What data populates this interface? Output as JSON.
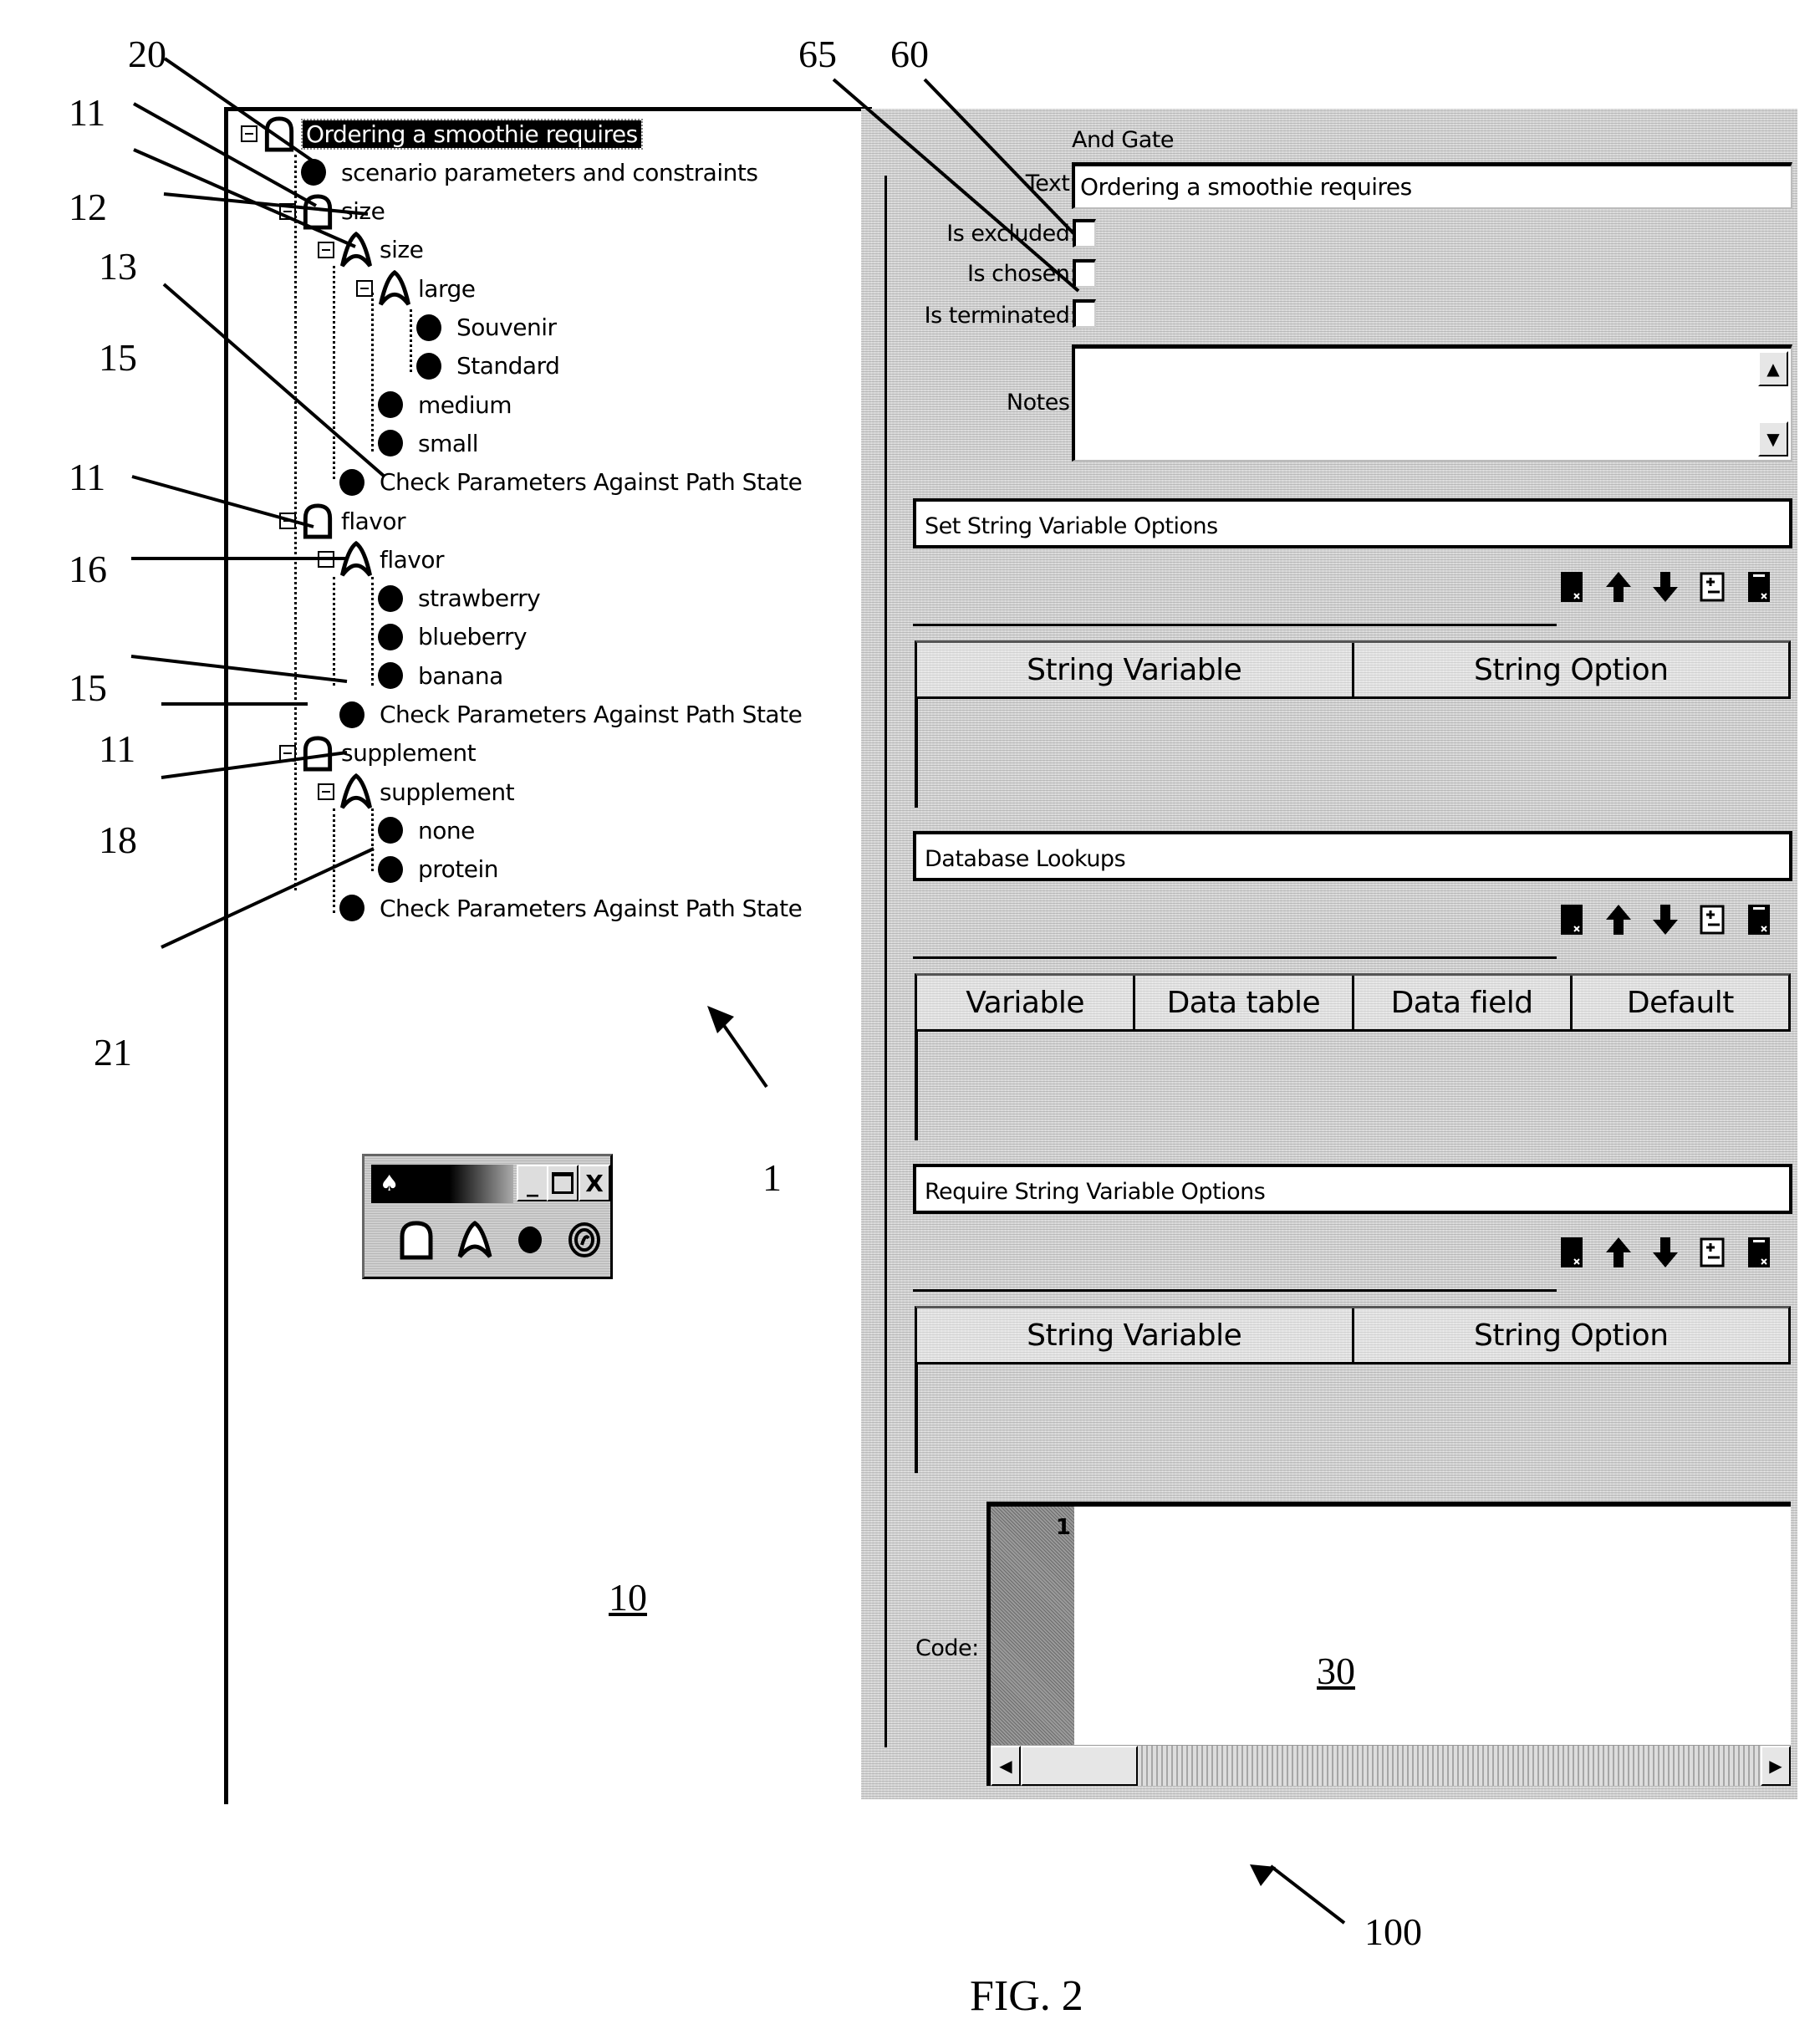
{
  "figure": {
    "caption": "FIG. 2",
    "reference_numerals": {
      "r20": "20",
      "r11a": "11",
      "r12": "12",
      "r13": "13",
      "r15a": "15",
      "r11b": "11",
      "r16": "16",
      "r15b": "15",
      "r11c": "11",
      "r18": "18",
      "r21": "21",
      "r1": "1",
      "r10": "10",
      "r30": "30",
      "r65": "65",
      "r60": "60",
      "r100": "100"
    }
  },
  "tree": {
    "rows": [
      {
        "label": "Ordering a smoothie requires",
        "icon": "and-gate-icon",
        "selected": true
      },
      {
        "label": "scenario parameters and constraints",
        "icon": "leaf-node-icon"
      },
      {
        "label": "size",
        "icon": "and-gate-icon"
      },
      {
        "label": "size",
        "icon": "or-gate-icon"
      },
      {
        "label": "large",
        "icon": "or-gate-icon"
      },
      {
        "label": "Souvenir",
        "icon": "leaf-node-icon"
      },
      {
        "label": "Standard",
        "icon": "leaf-node-icon"
      },
      {
        "label": "medium",
        "icon": "leaf-node-icon"
      },
      {
        "label": "small",
        "icon": "leaf-node-icon"
      },
      {
        "label": "Check Parameters Against Path State",
        "icon": "leaf-node-icon"
      },
      {
        "label": "flavor",
        "icon": "and-gate-icon"
      },
      {
        "label": "flavor",
        "icon": "or-gate-icon"
      },
      {
        "label": "strawberry",
        "icon": "leaf-node-icon"
      },
      {
        "label": "blueberry",
        "icon": "leaf-node-icon"
      },
      {
        "label": "banana",
        "icon": "leaf-node-icon"
      },
      {
        "label": "Check Parameters Against Path State",
        "icon": "leaf-node-icon"
      },
      {
        "label": "supplement",
        "icon": "and-gate-icon"
      },
      {
        "label": "supplement",
        "icon": "or-gate-icon"
      },
      {
        "label": "none",
        "icon": "leaf-node-icon"
      },
      {
        "label": "protein",
        "icon": "leaf-node-icon"
      },
      {
        "label": "Check Parameters Against Path State",
        "icon": "leaf-node-icon"
      }
    ]
  },
  "palette": {
    "title_icon": "app-icon",
    "minimize": "_",
    "maximize": "□",
    "close": "X",
    "tools": [
      "and-gate-icon",
      "or-gate-icon",
      "leaf-node-icon",
      "spiral-icon"
    ]
  },
  "properties": {
    "node_type": "And Gate",
    "text_label": "Text:",
    "text_value": "Ordering a smoothie requires",
    "is_excluded_label": "Is excluded:",
    "is_excluded": false,
    "is_chosen_label": "Is chosen:",
    "is_chosen": false,
    "is_terminated_label": "Is terminated:",
    "is_terminated": false,
    "notes_label": "Notes:",
    "notes_value": "",
    "sections": [
      {
        "title": "Set String Variable Options",
        "columns": [
          "String Variable",
          "String Option"
        ]
      },
      {
        "title": "Database Lookups",
        "columns": [
          "Variable",
          "Data table",
          "Data field",
          "Default"
        ]
      },
      {
        "title": "Require String Variable Options",
        "columns": [
          "String Variable",
          "String Option"
        ]
      }
    ],
    "toolbar_icons": [
      "delete-row-icon",
      "move-up-icon",
      "move-down-icon",
      "insert-row-icon",
      "clear-icon"
    ],
    "code_label": "Code:",
    "code_line_number": "1",
    "code_value": ""
  }
}
